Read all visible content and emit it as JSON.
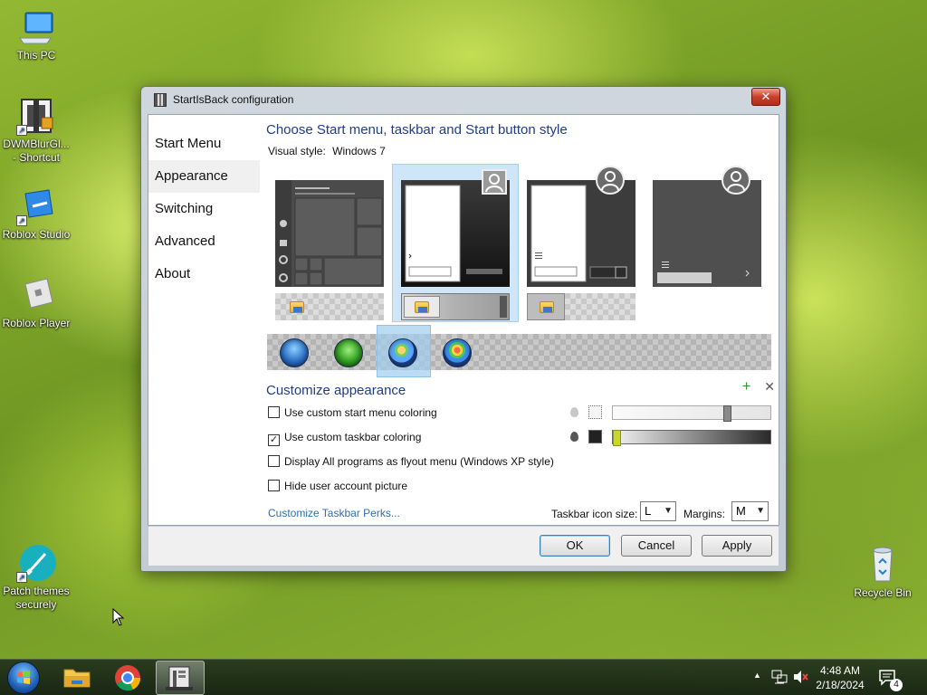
{
  "desktop": {
    "icons": [
      {
        "label": "This PC"
      },
      {
        "label": "DWMBlurGl...\n- Shortcut"
      },
      {
        "label": "Roblox Studio"
      },
      {
        "label": "Roblox Player"
      },
      {
        "label": "Patch themes\nsecurely"
      },
      {
        "label": "Recycle Bin"
      }
    ]
  },
  "window": {
    "title": "StartIsBack configuration",
    "close_label": "✕",
    "sidebar": {
      "items": [
        {
          "label": "Start Menu",
          "active": false
        },
        {
          "label": "Appearance",
          "active": true
        },
        {
          "label": "Switching",
          "active": false
        },
        {
          "label": "Advanced",
          "active": false
        },
        {
          "label": "About",
          "active": false
        }
      ]
    },
    "heading": "Choose Start menu, taskbar and Start button style",
    "visual_style_label": "Visual style:",
    "visual_style_value": "Windows 7",
    "customize": {
      "heading": "Customize appearance",
      "add_icon": "+",
      "remove_icon": "✕",
      "options": [
        {
          "label": "Use custom start menu coloring",
          "checked": false
        },
        {
          "label": "Use custom taskbar coloring",
          "checked": true
        },
        {
          "label": "Display All programs as flyout menu (Windows XP style)",
          "checked": false
        },
        {
          "label": "Hide user account picture",
          "checked": false
        }
      ],
      "start_menu_slider_value": 0.74,
      "taskbar_slider_value": 0.0,
      "perks_link": "Customize Taskbar Perks...",
      "taskbar_icon_size_label": "Taskbar icon size:",
      "taskbar_icon_size_value": "L",
      "margins_label": "Margins:",
      "margins_value": "M"
    },
    "buttons": {
      "ok": "OK",
      "cancel": "Cancel",
      "apply": "Apply"
    }
  },
  "taskbar": {
    "show_hidden_icon": "▲",
    "time": "4:48 AM",
    "date": "2/18/2024",
    "notification_count": "4"
  },
  "colors": {
    "accent_heading": "#1e3d8a",
    "link": "#2f6fb5",
    "selection": "#cfe6f8"
  }
}
